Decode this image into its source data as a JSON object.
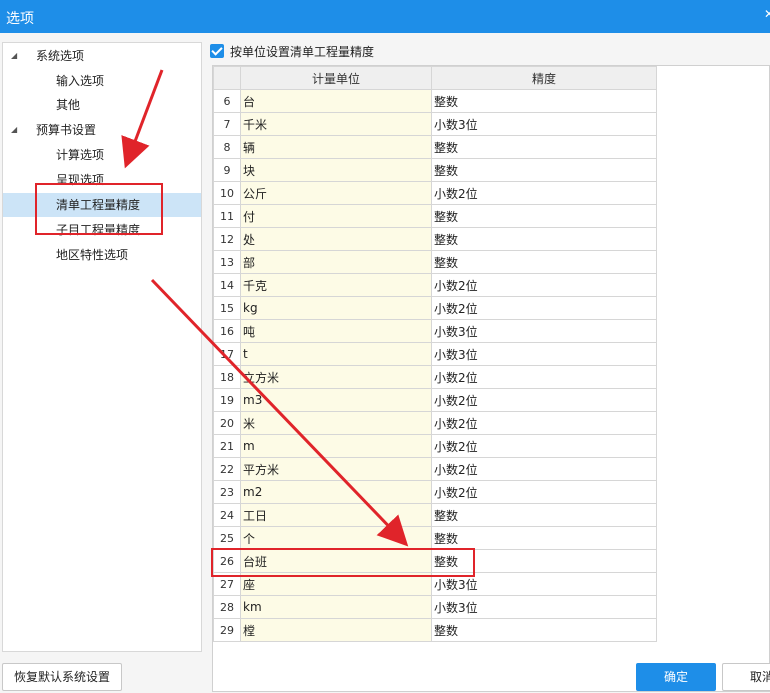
{
  "window": {
    "title": "选项"
  },
  "sidebar": {
    "items": [
      {
        "label": "系统选项",
        "level": 0,
        "expanded": true
      },
      {
        "label": "输入选项",
        "level": 1
      },
      {
        "label": "其他",
        "level": 1
      },
      {
        "label": "预算书设置",
        "level": 0,
        "expanded": true
      },
      {
        "label": "计算选项",
        "level": 1
      },
      {
        "label": "呈现选项",
        "level": 1
      },
      {
        "label": "清单工程量精度",
        "level": 1,
        "selected": true
      },
      {
        "label": "子目工程量精度",
        "level": 1
      },
      {
        "label": "地区特性选项",
        "level": 1
      }
    ]
  },
  "main": {
    "checkbox_label": "按单位设置清单工程量精度",
    "checkbox_checked": true,
    "grid": {
      "headers": [
        "",
        "计量单位",
        "精度"
      ],
      "rows": [
        {
          "n": "6",
          "unit": "台",
          "precision": "整数"
        },
        {
          "n": "7",
          "unit": "千米",
          "precision": "小数3位"
        },
        {
          "n": "8",
          "unit": "辆",
          "precision": "整数"
        },
        {
          "n": "9",
          "unit": "块",
          "precision": "整数"
        },
        {
          "n": "10",
          "unit": "公斤",
          "precision": "小数2位"
        },
        {
          "n": "11",
          "unit": "付",
          "precision": "整数"
        },
        {
          "n": "12",
          "unit": "处",
          "precision": "整数"
        },
        {
          "n": "13",
          "unit": "部",
          "precision": "整数"
        },
        {
          "n": "14",
          "unit": "千克",
          "precision": "小数2位"
        },
        {
          "n": "15",
          "unit": "kg",
          "precision": "小数2位"
        },
        {
          "n": "16",
          "unit": "吨",
          "precision": "小数3位"
        },
        {
          "n": "17",
          "unit": "t",
          "precision": "小数3位"
        },
        {
          "n": "18",
          "unit": "立方米",
          "precision": "小数2位"
        },
        {
          "n": "19",
          "unit": "m3",
          "precision": "小数2位"
        },
        {
          "n": "20",
          "unit": "米",
          "precision": "小数2位"
        },
        {
          "n": "21",
          "unit": "m",
          "precision": "小数2位"
        },
        {
          "n": "22",
          "unit": "平方米",
          "precision": "小数2位"
        },
        {
          "n": "23",
          "unit": "m2",
          "precision": "小数2位"
        },
        {
          "n": "24",
          "unit": "工日",
          "precision": "整数"
        },
        {
          "n": "25",
          "unit": "个",
          "precision": "整数"
        },
        {
          "n": "26",
          "unit": "台班",
          "precision": "整数"
        },
        {
          "n": "27",
          "unit": "座",
          "precision": "小数3位"
        },
        {
          "n": "28",
          "unit": "km",
          "precision": "小数3位"
        },
        {
          "n": "29",
          "unit": "樘",
          "precision": "整数"
        }
      ]
    }
  },
  "footer": {
    "restore_label": "恢复默认系统设置",
    "ok_label": "确定",
    "cancel_label": "取消"
  },
  "colors": {
    "accent": "#1e8ee8",
    "annotation": "#e0242a",
    "unit_cell": "#fdfbe6",
    "selected_row": "#cce4f7"
  }
}
